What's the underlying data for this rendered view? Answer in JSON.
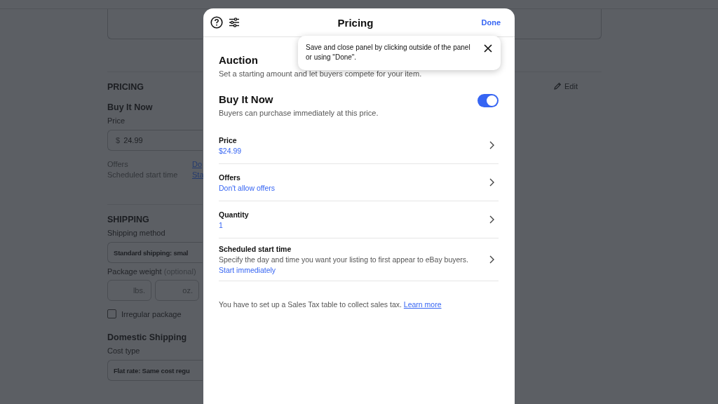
{
  "background": {
    "pricing": {
      "heading": "PRICING",
      "edit": "Edit",
      "subheading": "Buy It Now",
      "price_label": "Price",
      "price_currency": "$",
      "price_value": "24.99",
      "offers_label": "Offers",
      "offers_value": "Do",
      "start_label": "Scheduled start time",
      "start_value": "Sta"
    },
    "shipping": {
      "heading": "SHIPPING",
      "method_label": "Shipping method",
      "method_value": "Standard shipping: smal",
      "weight_label": "Package weight",
      "weight_hint": "(optional)",
      "lbs_placeholder": "lbs.",
      "oz_placeholder": "oz.",
      "irregular": {
        "label": "Irregular package",
        "checked": false
      },
      "domestic_heading": "Domestic Shipping",
      "cost_label": "Cost type",
      "cost_value": "Flat rate: Same cost regu"
    }
  },
  "panel": {
    "title": "Pricing",
    "done": "Done",
    "tooltip": "Save and close panel by clicking outside of the panel or using \"Done\".",
    "formats": [
      {
        "kind": "plain",
        "title": "Auction",
        "description": "Set a starting amount and let buyers compete for your item."
      },
      {
        "kind": "toggle",
        "title": "Buy It Now",
        "description": "Buyers can purchase immediately at this price.",
        "on": true
      }
    ],
    "rows": [
      {
        "label": "Price",
        "value": "$24.99"
      },
      {
        "label": "Offers",
        "value": "Don't allow offers"
      },
      {
        "label": "Quantity",
        "value": "1"
      },
      {
        "label": "Scheduled start time",
        "description": "Specify the day and time you want your listing to first appear to eBay buyers.",
        "value": "Start immediately"
      }
    ],
    "note": "You have to set up a Sales Tax table to collect sales tax.",
    "note_link": "Learn more"
  }
}
